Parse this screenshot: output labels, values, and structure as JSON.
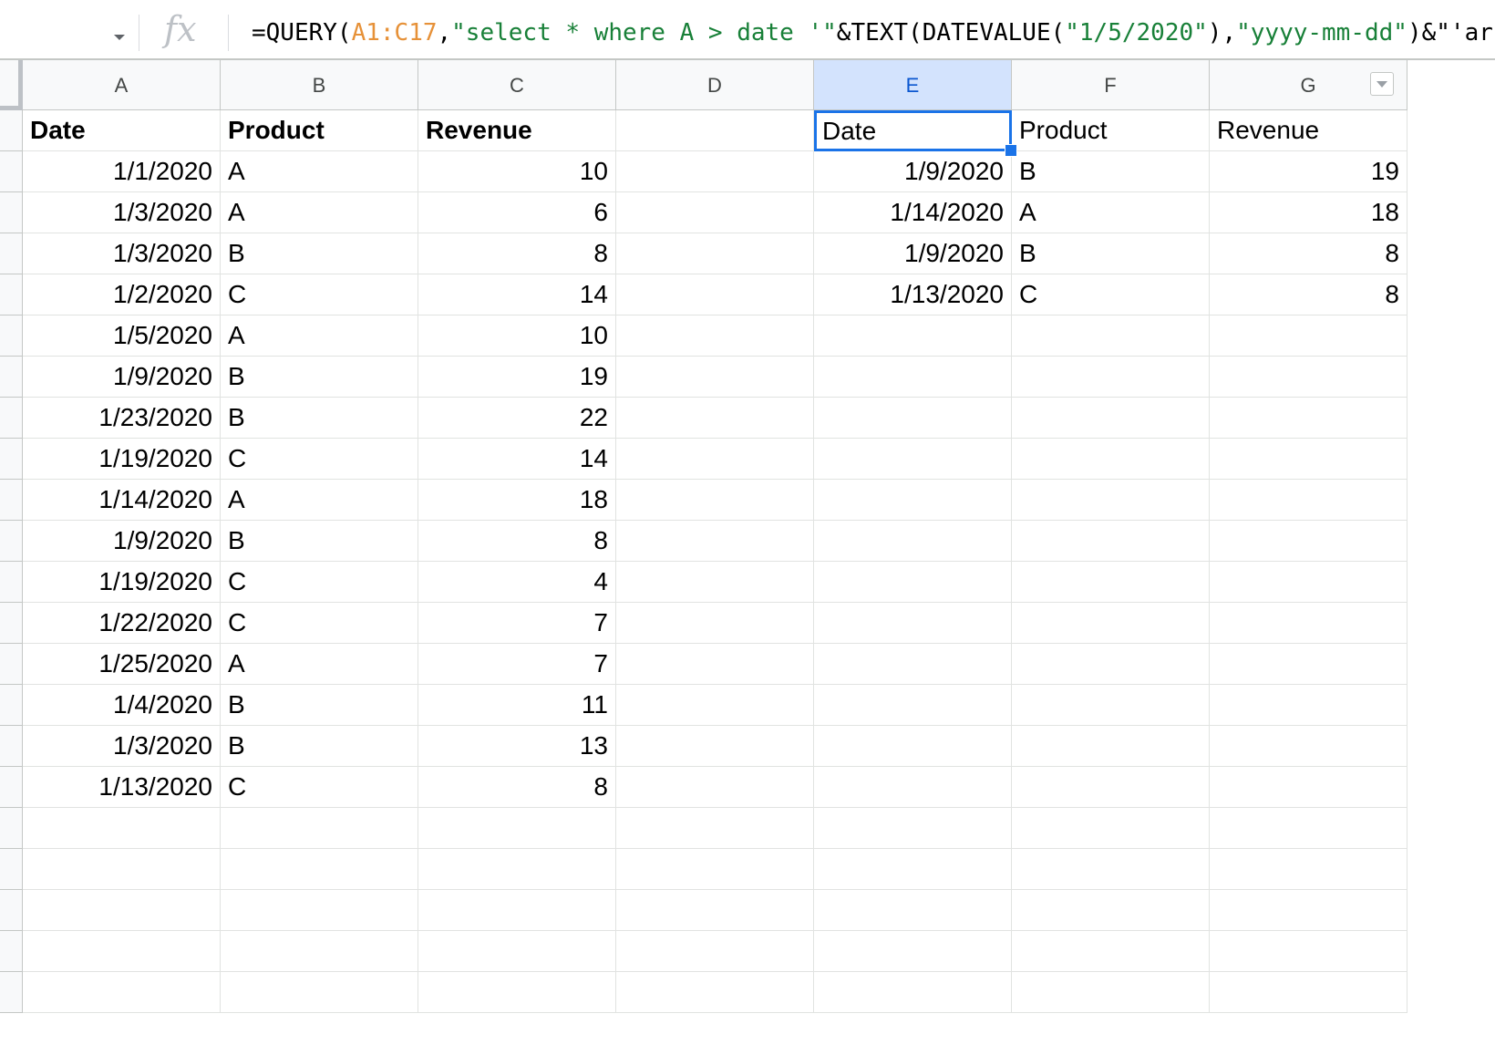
{
  "formula_bar": {
    "fx_label": "fx",
    "segments": [
      {
        "text": "=QUERY(",
        "kind": "plain"
      },
      {
        "text": "A1:C17",
        "kind": "ref"
      },
      {
        "text": ",",
        "kind": "plain"
      },
      {
        "text": "\"select * where A > date '\"",
        "kind": "str"
      },
      {
        "text": "&TEXT(DATEVALUE(",
        "kind": "plain"
      },
      {
        "text": "\"1/5/2020\"",
        "kind": "str"
      },
      {
        "text": "),",
        "kind": "plain"
      },
      {
        "text": "\"yyyy-mm-dd\"",
        "kind": "str"
      },
      {
        "text": ")&\"'ar",
        "kind": "plain"
      }
    ]
  },
  "columns": [
    "A",
    "B",
    "C",
    "D",
    "E",
    "F",
    "G"
  ],
  "selected_column": "E",
  "colors": {
    "selection": "#1a73e8",
    "ref": "#e69138",
    "string": "#188038"
  },
  "source_table": {
    "headers": [
      "Date",
      "Product",
      "Revenue"
    ],
    "rows": [
      [
        "1/1/2020",
        "A",
        "10"
      ],
      [
        "1/3/2020",
        "A",
        "6"
      ],
      [
        "1/3/2020",
        "B",
        "8"
      ],
      [
        "1/2/2020",
        "C",
        "14"
      ],
      [
        "1/5/2020",
        "A",
        "10"
      ],
      [
        "1/9/2020",
        "B",
        "19"
      ],
      [
        "1/23/2020",
        "B",
        "22"
      ],
      [
        "1/19/2020",
        "C",
        "14"
      ],
      [
        "1/14/2020",
        "A",
        "18"
      ],
      [
        "1/9/2020",
        "B",
        "8"
      ],
      [
        "1/19/2020",
        "C",
        "4"
      ],
      [
        "1/22/2020",
        "C",
        "7"
      ],
      [
        "1/25/2020",
        "A",
        "7"
      ],
      [
        "1/4/2020",
        "B",
        "11"
      ],
      [
        "1/3/2020",
        "B",
        "13"
      ],
      [
        "1/13/2020",
        "C",
        "8"
      ]
    ]
  },
  "result_table": {
    "headers": [
      "Date",
      "Product",
      "Revenue"
    ],
    "rows": [
      [
        "1/9/2020",
        "B",
        "19"
      ],
      [
        "1/14/2020",
        "A",
        "18"
      ],
      [
        "1/9/2020",
        "B",
        "8"
      ],
      [
        "1/13/2020",
        "C",
        "8"
      ]
    ]
  }
}
